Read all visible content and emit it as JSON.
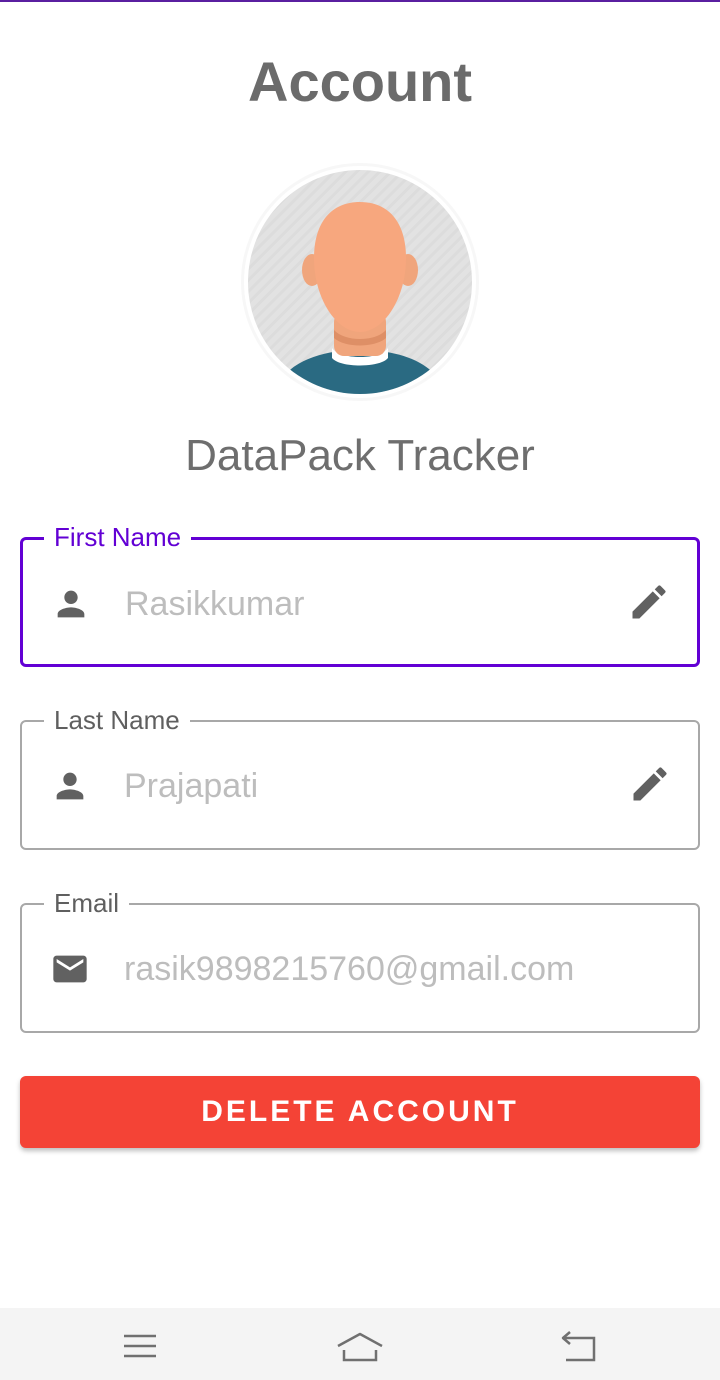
{
  "header": {
    "title": "Account"
  },
  "profile": {
    "app_name": "DataPack Tracker"
  },
  "form": {
    "first_name": {
      "label": "First Name",
      "value": "Rasikkumar",
      "icon": "person-icon",
      "state": "focused"
    },
    "last_name": {
      "label": "Last Name",
      "value": "Prajapati",
      "icon": "person-icon"
    },
    "email": {
      "label": "Email",
      "value": "rasik9898215760@gmail.com",
      "icon": "mail-icon"
    }
  },
  "actions": {
    "delete_label": "DELETE ACCOUNT"
  },
  "nav": {
    "items": [
      "menu-icon",
      "home-icon",
      "back-icon"
    ]
  },
  "colors": {
    "accent": "#6200d4",
    "danger": "#f44336",
    "title": "#6b6b6b",
    "placeholder": "#bdbdbd"
  }
}
